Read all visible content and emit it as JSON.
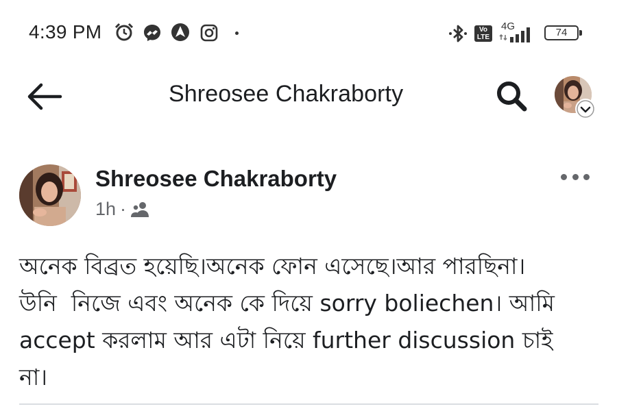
{
  "status_bar": {
    "time": "4:39 PM",
    "left_icons": [
      "alarm-icon",
      "messenger-icon",
      "arrow-app-icon",
      "instagram-icon"
    ],
    "right_icons": [
      "bluetooth-icon",
      "volte-icon",
      "signal-icon",
      "battery-icon"
    ],
    "network": "4G",
    "volte_label": "Vo LTE",
    "battery_level": "74"
  },
  "header": {
    "title": "Shreosee Chakraborty",
    "back_icon": "back-arrow-icon",
    "search_icon": "search-icon"
  },
  "post": {
    "author": "Shreosee Chakraborty",
    "time": "1h",
    "separator": "·",
    "audience_icon": "friends-icon",
    "text": "অনেক বিব্রত হয়েছি।অনেক ফোন এসেছে।আর পারছিনা।\nউনি  নিজে এবং অনেক কে দিয়ে sorry boliechen। আমি\naccept করলাম আর এটা নিয়ে further discussion চাই\nনা।"
  },
  "colors": {
    "text_primary": "#1c1e21",
    "text_secondary": "#65676b",
    "divider": "#dadde1",
    "background": "#ffffff"
  }
}
